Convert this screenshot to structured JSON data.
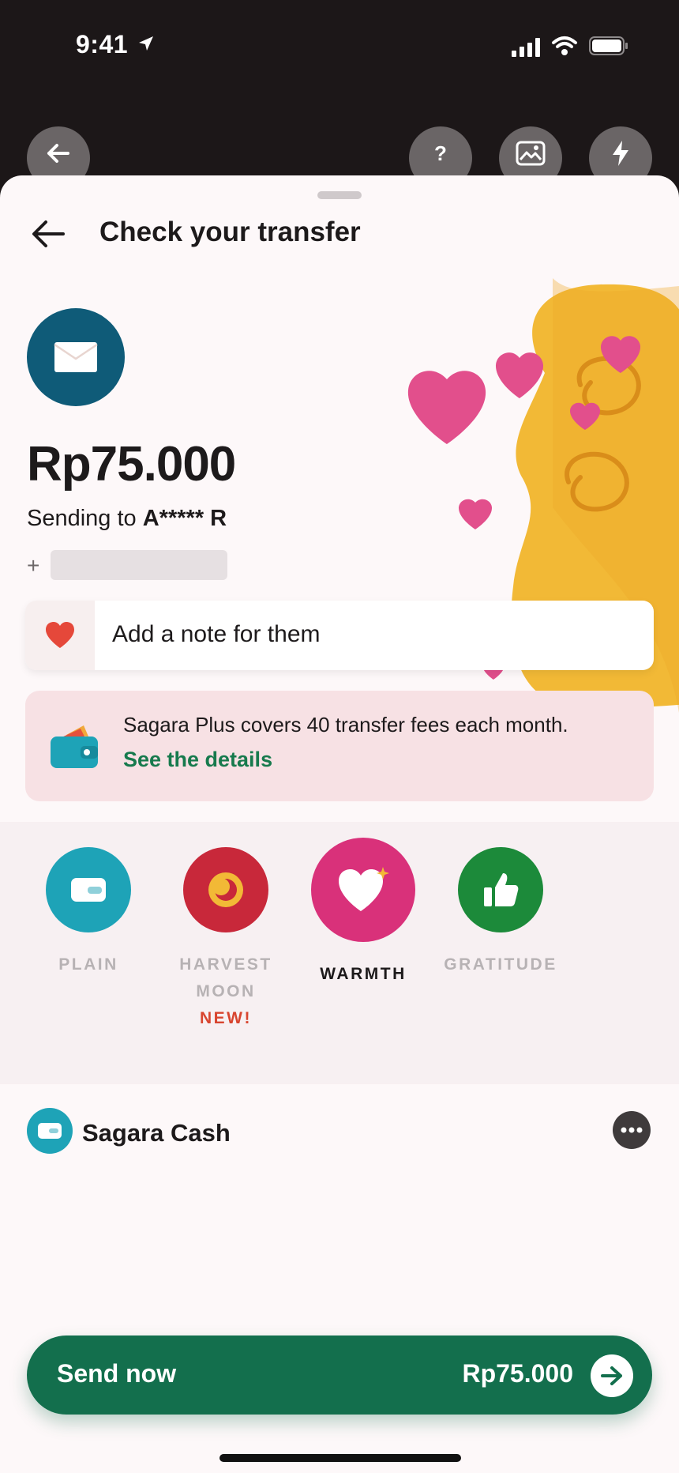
{
  "status_bar": {
    "time": "9:41"
  },
  "sheet": {
    "title": "Check your transfer"
  },
  "transfer": {
    "amount": "Rp75.000",
    "sending_prefix": "Sending to ",
    "recipient": "A***** R",
    "plus": "+"
  },
  "note": {
    "placeholder": "Add a note for them"
  },
  "promo": {
    "text": "Sagara Plus covers 40 transfer fees each month.",
    "link": "See the details"
  },
  "themes": [
    {
      "label": "PLAIN",
      "color": "#1ea3b7",
      "selected": false
    },
    {
      "label": "HARVEST MOON",
      "badge": "NEW!",
      "color": "#c8283a",
      "selected": false
    },
    {
      "label": "WARMTH",
      "color": "#d9317a",
      "selected": true
    },
    {
      "label": "GRATITUDE",
      "color": "#1c8a3a",
      "selected": false
    }
  ],
  "payment_source": {
    "label": "Sagara Cash"
  },
  "send_button": {
    "label": "Send now",
    "amount": "Rp75.000"
  },
  "colors": {
    "brand_green": "#136f4d",
    "link_green": "#177a4d",
    "heart_pink": "#e24f8c",
    "envelope_blue": "#0f5b78"
  },
  "icons": [
    "location-arrow-icon",
    "signal-icon",
    "wifi-icon",
    "battery-icon",
    "back-arrow-icon",
    "help-icon",
    "gallery-icon",
    "lightning-icon",
    "envelope-icon",
    "heart-icon",
    "wallet-icon",
    "more-icon",
    "arrow-right-icon"
  ]
}
